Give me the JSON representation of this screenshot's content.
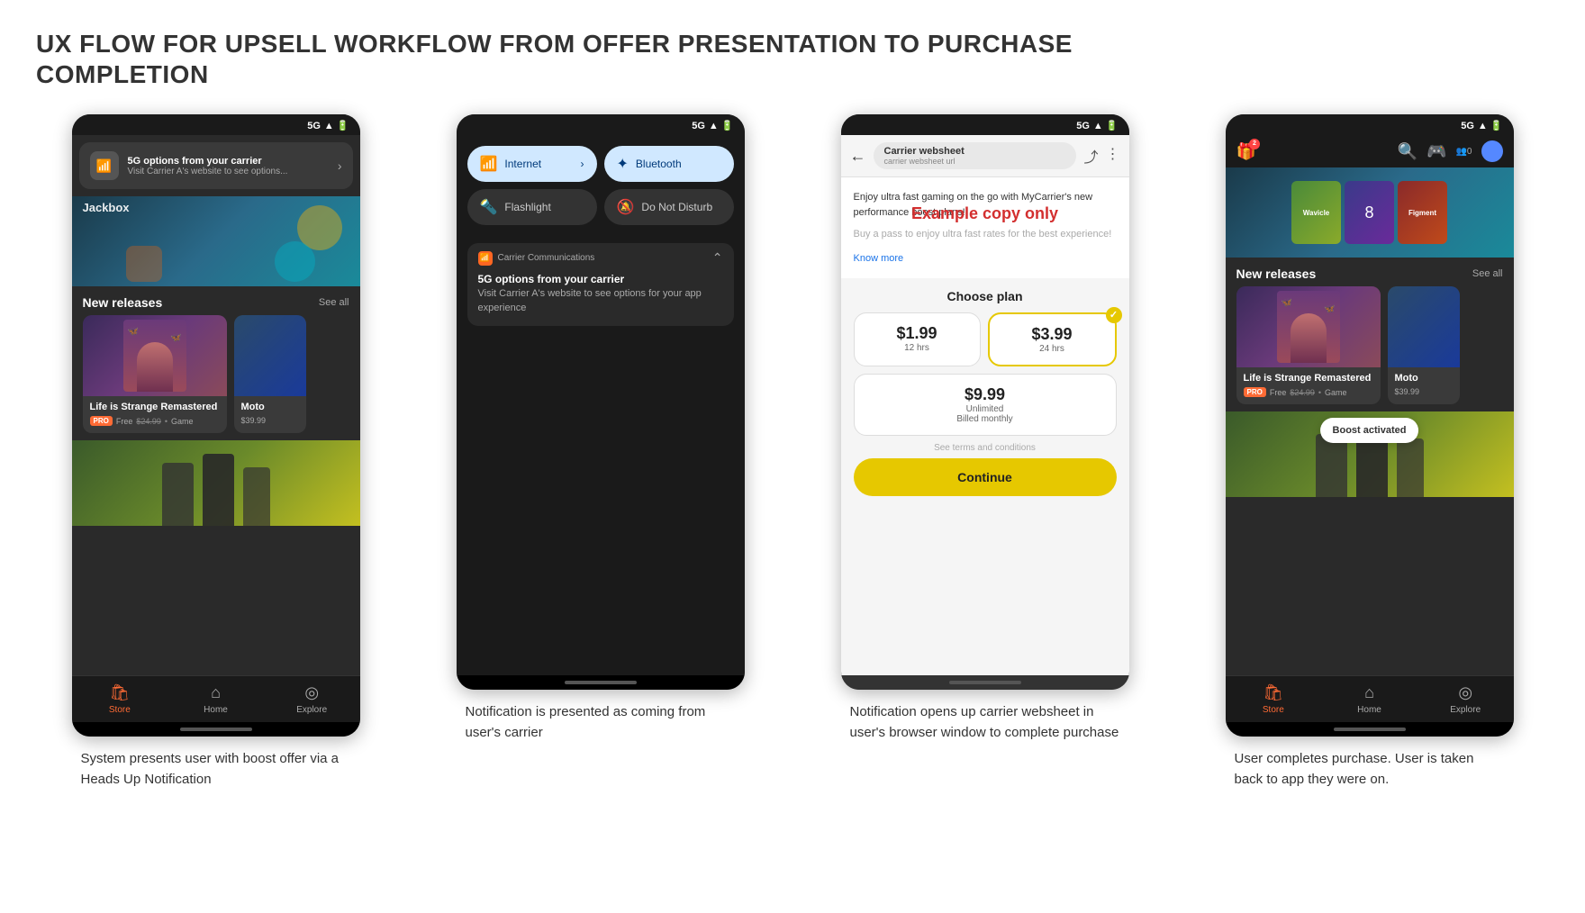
{
  "page": {
    "title_line1": "UX FLOW FOR UPSELL WORKFLOW FROM OFFER PRESENTATION TO PURCHASE",
    "title_line2": "COMPLETION"
  },
  "steps": [
    {
      "id": "step1",
      "caption": "System presents user with boost offer via a Heads Up Notification"
    },
    {
      "id": "step2",
      "caption": "Notification is presented as coming from user's carrier"
    },
    {
      "id": "step3",
      "caption": "Notification opens up carrier websheet in user's browser window to complete purchase"
    },
    {
      "id": "step4",
      "caption": "User completes purchase. User is taken back to app they were on."
    }
  ],
  "screen1": {
    "status": "5G",
    "notif_title": "5G options from your carrier",
    "notif_sub": "Visit Carrier A's website to see options...",
    "section_title": "New releases",
    "see_all": "See all",
    "game1_title": "Life is Strange Remastered",
    "game1_badge": "PRO",
    "game1_price": "Free",
    "game1_price_orig": "$24.99",
    "game1_type": "Game",
    "game2_title": "Moto",
    "game2_price": "$39.99",
    "nav_store": "Store",
    "nav_home": "Home",
    "nav_explore": "Explore"
  },
  "screen2": {
    "status": "5G",
    "tile1_label": "Internet",
    "tile2_label": "Bluetooth",
    "tile3_label": "Flashlight",
    "tile4_label": "Do Not Disturb",
    "notif_app": "Carrier Communications",
    "notif_title": "5G options from your carrier",
    "notif_body": "Visit Carrier A's website to see options for your app experience"
  },
  "screen3": {
    "status": "5G",
    "url_title": "Carrier websheet",
    "url_sub": "carrier websheet url",
    "intro_text": "Enjoy ultra fast gaming on the go with MyCarrier's new performance boost plans!",
    "intro_text2": "Buy a pass to enjoy ultra fast rates for the best experience!",
    "know_more": "Know more",
    "example_copy": "Example copy only",
    "choose_plan_title": "Choose plan",
    "plan1_price": "$1.99",
    "plan1_duration": "12 hrs",
    "plan2_price": "$3.99",
    "plan2_duration": "24 hrs",
    "plan3_price": "$9.99",
    "plan3_unlimited": "Unlimited",
    "plan3_billed": "Billed monthly",
    "terms": "See terms and conditions",
    "continue_btn": "Continue"
  },
  "screen4": {
    "status": "5G",
    "section_title": "New releases",
    "see_all": "See all",
    "game1_title": "Life is Strange Remastered",
    "game1_badge": "PRO",
    "game1_price": "Free",
    "game1_price_orig": "$24.99",
    "game1_type": "Game",
    "game2_title": "Moto",
    "game2_price": "$39.99",
    "boost_toast": "Boost activated",
    "nav_store": "Store",
    "nav_home": "Home",
    "nav_explore": "Explore"
  },
  "colors": {
    "accent_orange": "#ff6b35",
    "accent_yellow": "#e6c800",
    "pro_badge": "#ff6b35",
    "error_red": "#d32f2f"
  }
}
